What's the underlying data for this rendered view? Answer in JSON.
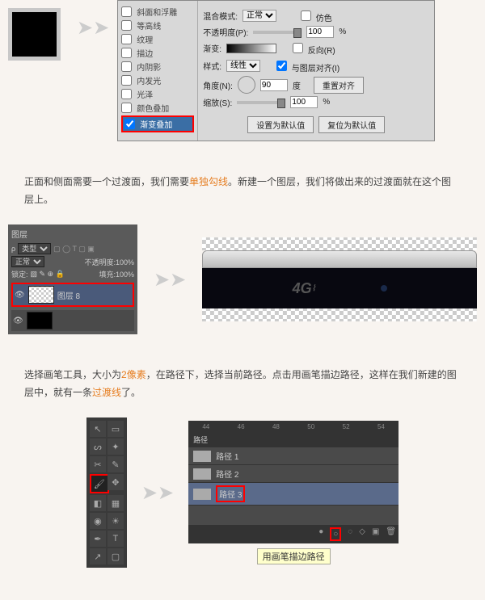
{
  "sec1": {
    "fx_list": [
      "斜面和浮雕",
      "等高线",
      "纹理",
      "描边",
      "内阴影",
      "内发光",
      "光泽",
      "颜色叠加",
      "渐变叠加"
    ],
    "fx_selected_index": 8,
    "right": {
      "blend_mode_label": "混合模式:",
      "blend_mode_value": "正常",
      "dither_label": "仿色",
      "opacity_label": "不透明度(P):",
      "opacity_value": "100",
      "pct": "%",
      "gradient_label": "渐变:",
      "reverse_label": "反向(R)",
      "style_label": "样式:",
      "style_value": "线性",
      "align_layer_label": "与图层对齐(I)",
      "angle_label": "角度(N):",
      "angle_value": "90",
      "degree": "度",
      "reset_align_btn": "重置对齐",
      "scale_label": "缩放(S):",
      "scale_value": "100",
      "set_default_btn": "设置为默认值",
      "reset_default_btn": "复位为默认值"
    }
  },
  "text1": {
    "part1": "正面和侧面需要一个过渡面，我们需要",
    "hl1": "单独勾线",
    "part2": "。新建一个图层，我们将做出来的过渡面就在这个图层上。"
  },
  "sec2": {
    "layers": {
      "tab": "图层",
      "type_label": "类型",
      "blend": "正常",
      "opacity_label": "不透明度:",
      "opacity_value": "100%",
      "lock_label": "锁定:",
      "fill_label": "填充:",
      "fill_value": "100%",
      "layer_name": "图层 8"
    },
    "phone_text": "4G"
  },
  "text2": {
    "part1": "选择画笔工具，大小为",
    "hl1": "2像素",
    "part2": "，在路径下，选择当前路径。点击用画笔描边路径，这样在我们新建的图层中，就有一条",
    "hl2": "过渡线",
    "part3": "了。"
  },
  "sec3": {
    "ruler": [
      "44",
      "46",
      "48",
      "50",
      "52",
      "54"
    ],
    "tabs_label": "路径",
    "paths": [
      "路径 1",
      "路径 2",
      "路径 3"
    ],
    "selected_path_index": 2,
    "tooltip": "用画笔描边路径"
  }
}
